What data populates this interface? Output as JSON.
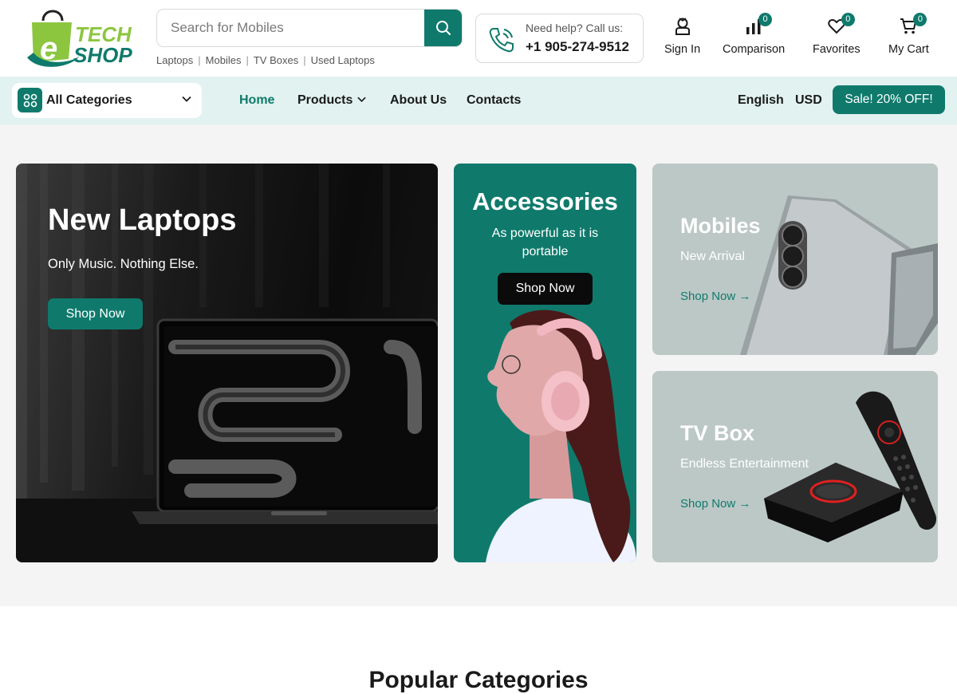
{
  "header": {
    "logo": {
      "word1": "TECH",
      "word2": "SHOP",
      "letter": "e"
    },
    "search": {
      "placeholder": "Search for Mobiles"
    },
    "quick_links": [
      "Laptops",
      "Mobiles",
      "TV Boxes",
      "Used Laptops"
    ],
    "help": {
      "label": "Need help? Call us:",
      "phone": "+1 905-274-9512"
    },
    "actions": {
      "sign_in": "Sign In",
      "comparison": {
        "label": "Comparison",
        "count": "0"
      },
      "favorites": {
        "label": "Favorites",
        "count": "0"
      },
      "cart": {
        "label": "My Cart",
        "count": "0"
      }
    }
  },
  "nav": {
    "categories_label": "All Categories",
    "links": {
      "home": "Home",
      "products": "Products",
      "about": "About Us",
      "contacts": "Contacts"
    },
    "language": "English",
    "currency": "USD",
    "sale_label": "Sale! 20% OFF!"
  },
  "hero": {
    "laptop": {
      "title": "New Laptops",
      "subtitle": "Only Music. Nothing Else.",
      "button": "Shop Now"
    },
    "accessories": {
      "title": "Accessories",
      "subtitle": "As powerful as it is portable",
      "button": "Shop Now"
    },
    "mobiles": {
      "title": "Mobiles",
      "subtitle": "New Arrival",
      "link": "Shop Now →"
    },
    "tvbox": {
      "title": "TV Box",
      "subtitle": "Endless Entertainment",
      "link": "Shop Now →"
    }
  },
  "sections": {
    "popular_title": "Popular Categories"
  },
  "colors": {
    "accent": "#0f7a6c",
    "nav_bg": "#e1f2f0",
    "card_gray": "#bcc8c6",
    "logo_green": "#8cc63f"
  }
}
